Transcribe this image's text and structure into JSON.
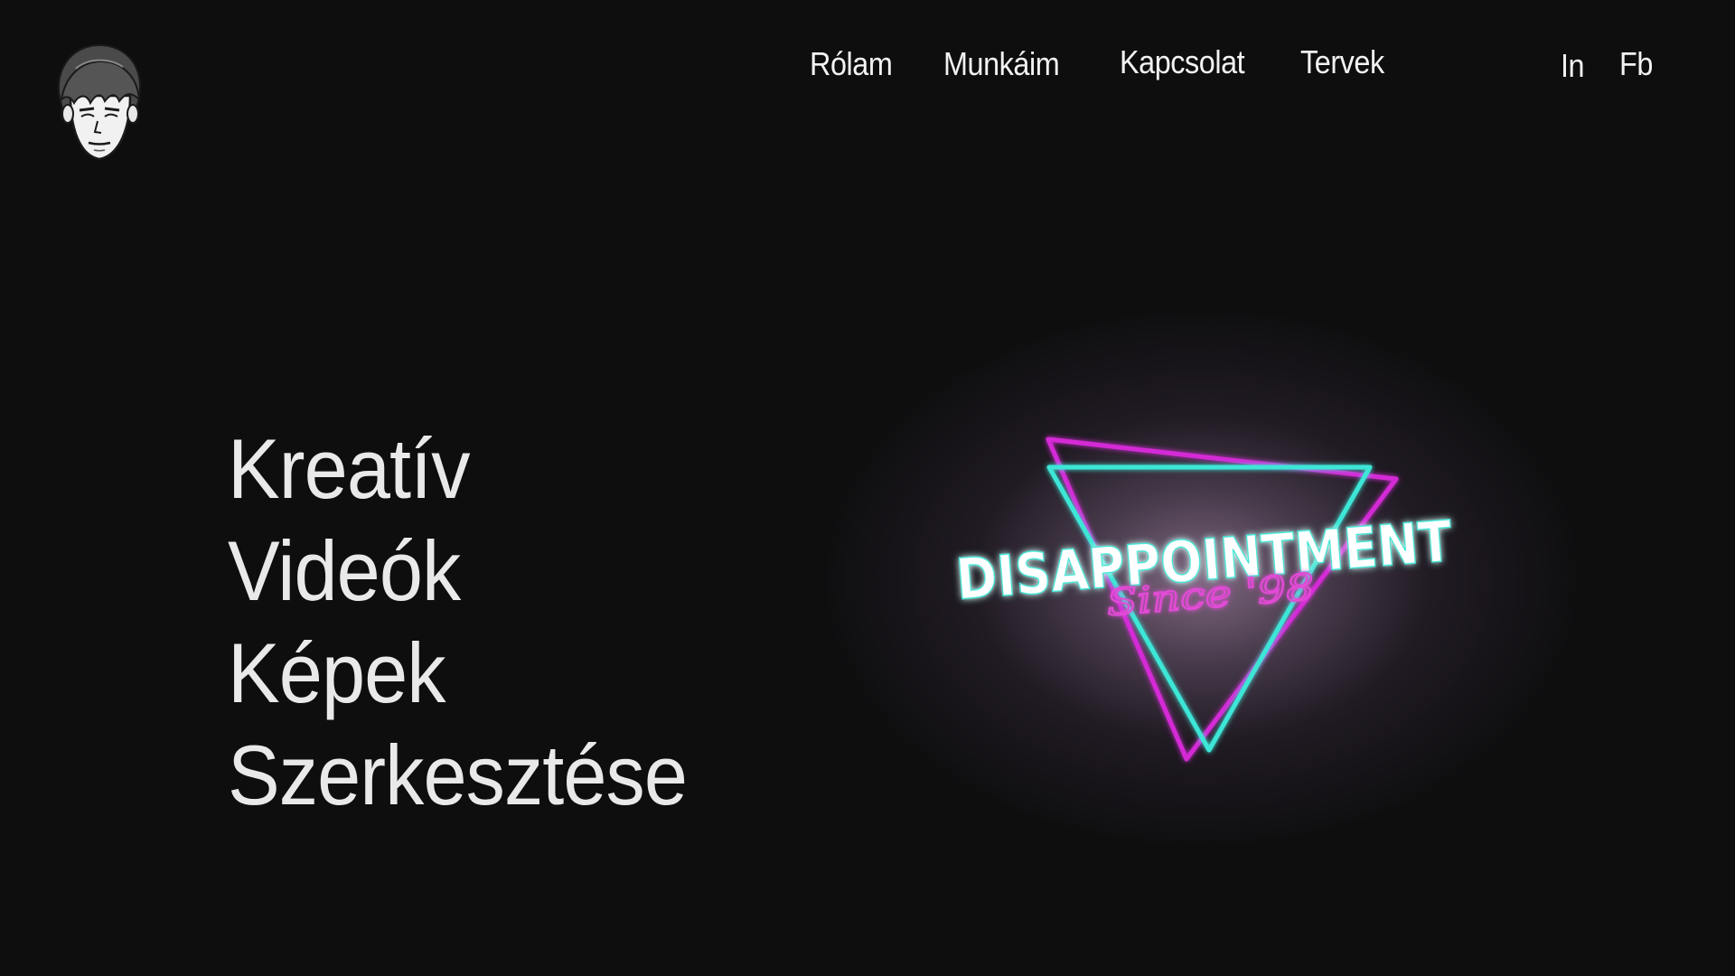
{
  "header": {
    "avatar_icon": "cartoon-face-avatar-icon",
    "nav": {
      "rolam": "Rólam",
      "munkaim": "Munkáim",
      "kapcsolat": "Kapcsolat",
      "tervek": "Tervek"
    },
    "social": {
      "in": "In",
      "fb": "Fb"
    }
  },
  "hero": {
    "lines": [
      "Kreatív",
      "Videók",
      "Képek",
      "Szerkesztése"
    ],
    "logo": {
      "main_text": "DISAPPOINTMENT",
      "sub_text": "Since '98",
      "colors": {
        "magenta": "#d42ad6",
        "cyan": "#3ee6d6"
      }
    }
  },
  "colors": {
    "background": "#0e0e0f",
    "text": "#f2f2f2"
  }
}
